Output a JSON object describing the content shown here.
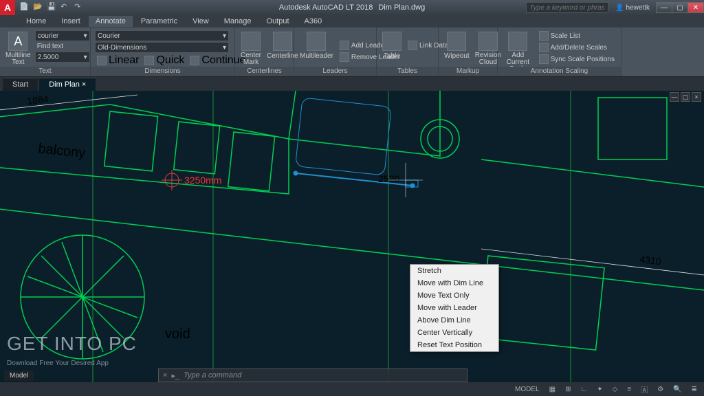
{
  "app": {
    "brand": "A",
    "title": "Autodesk AutoCAD LT 2018",
    "document": "Dim Plan.dwg",
    "search_placeholder": "Type a keyword or phrase",
    "user": "hewettk"
  },
  "menus": [
    "Home",
    "Insert",
    "Annotate",
    "Parametric",
    "View",
    "Manage",
    "Output",
    "A360"
  ],
  "active_menu": "Annotate",
  "ribbon": {
    "text": {
      "title": "Text",
      "main": "Multiline\nText",
      "font_combo": "courier",
      "find": "Find text",
      "height": "2.5000"
    },
    "dimensions": {
      "title": "Dimensions",
      "font": "Courier",
      "style": "Old-Dimensions",
      "linear": "Linear",
      "quick": "Quick",
      "continue": "Continue"
    },
    "centerlines": {
      "title": "Centerlines",
      "mark": "Center\nMark",
      "line": "Centerline"
    },
    "leaders": {
      "title": "Leaders",
      "main": "Multileader",
      "add": "Add Leader",
      "remove": "Remove Leader"
    },
    "tables": {
      "title": "Tables",
      "main": "Table",
      "link": "Link Data"
    },
    "markup": {
      "title": "Markup",
      "wipeout": "Wipeout",
      "cloud": "Revision\nCloud"
    },
    "scaling": {
      "title": "Annotation Scaling",
      "add": "Add\nCurrent Scale",
      "list": "Scale List",
      "adddel": "Add/Delete Scales",
      "sync": "Sync Scale Positions"
    }
  },
  "tabs": {
    "start": "Start",
    "file": "Dim Plan"
  },
  "context_menu": [
    "Stretch",
    "Move with Dim Line",
    "Move Text Only",
    "Move with Leader",
    "Above Dim Line",
    "Center Vertically",
    "Reset Text Position"
  ],
  "drawing": {
    "dim1": "1884",
    "dim2": "4310",
    "dim_active": "2520",
    "dim_red": "3250mm",
    "label_balcony": "balcony",
    "label_void": "void"
  },
  "cmd": {
    "placeholder": "Type a command"
  },
  "status": {
    "model": "MODEL",
    "model_tab": "Model"
  },
  "watermark": {
    "line1": "GET INTO PC",
    "line2": "Download Free Your Desired App"
  }
}
